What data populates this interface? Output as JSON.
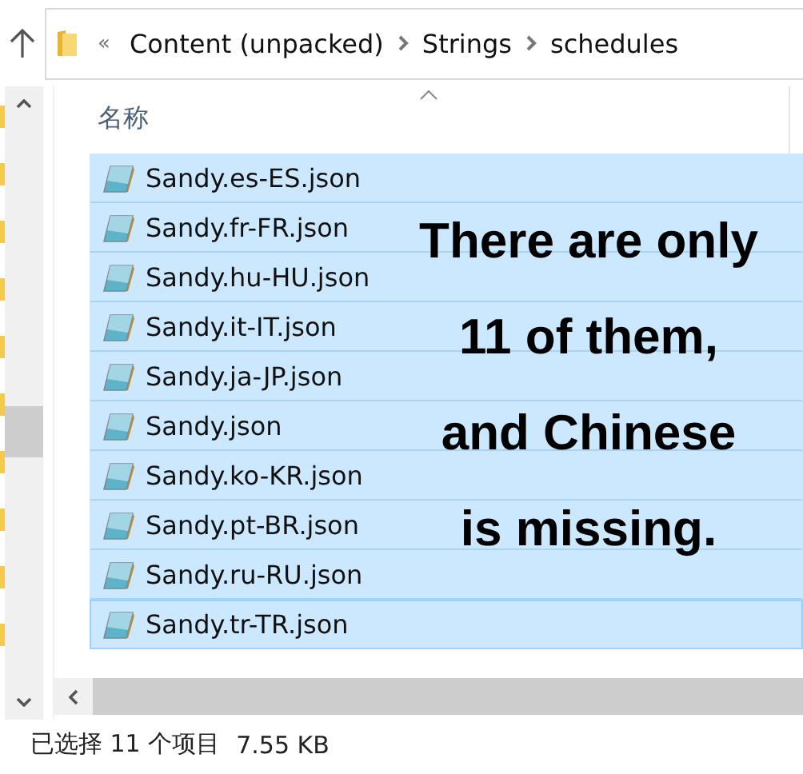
{
  "address_bar": {
    "overflow": "«",
    "path": [
      "Content (unpacked)",
      "Strings",
      "schedules"
    ]
  },
  "column_header": {
    "name": "名称",
    "sorted": true
  },
  "files": [
    {
      "name": "Sandy.es-ES.json",
      "selected": true,
      "focused": false
    },
    {
      "name": "Sandy.fr-FR.json",
      "selected": true,
      "focused": false
    },
    {
      "name": "Sandy.hu-HU.json",
      "selected": true,
      "focused": false
    },
    {
      "name": "Sandy.it-IT.json",
      "selected": true,
      "focused": false
    },
    {
      "name": "Sandy.ja-JP.json",
      "selected": true,
      "focused": false
    },
    {
      "name": "Sandy.json",
      "selected": true,
      "focused": false
    },
    {
      "name": "Sandy.ko-KR.json",
      "selected": true,
      "focused": false
    },
    {
      "name": "Sandy.pt-BR.json",
      "selected": true,
      "focused": false
    },
    {
      "name": "Sandy.ru-RU.json",
      "selected": true,
      "focused": false
    },
    {
      "name": "Sandy.tr-TR.json",
      "selected": true,
      "focused": true
    }
  ],
  "annotation": {
    "lines": [
      "There are only",
      "11 of them,",
      "and Chinese",
      "is missing."
    ]
  },
  "status_bar": {
    "selection": "已选择 11 个项目",
    "size": "7.55 KB"
  }
}
